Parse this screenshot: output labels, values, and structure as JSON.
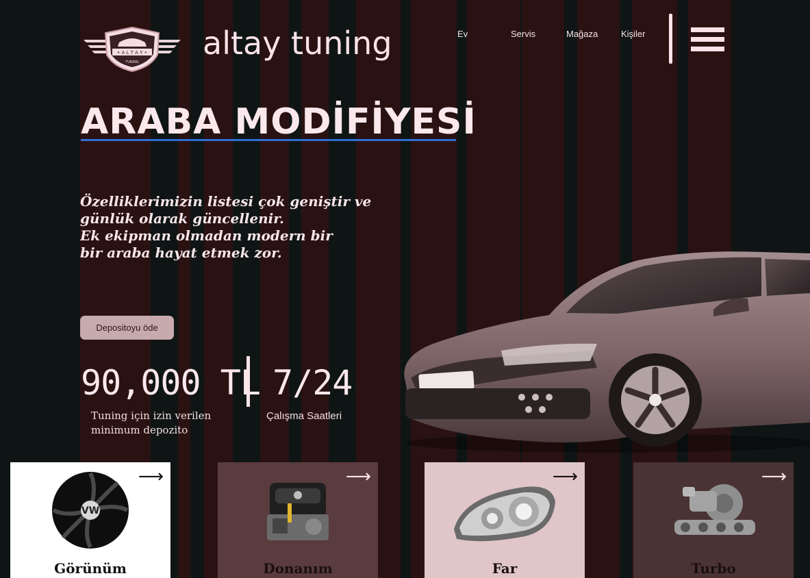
{
  "colors": {
    "background": "#0f1515",
    "stripe_dark_red": "#2a1212",
    "accent_pink": "#fbe3e8",
    "underline_blue": "#2d6fd6",
    "button": "#c7aaae"
  },
  "brand": {
    "name": "altay tuning",
    "logo_icon": "altay-winged-shield-logo"
  },
  "nav": {
    "items": [
      "Ev",
      "Servis",
      "Mağaza",
      "Kişiler"
    ],
    "menu_icon": "hamburger-menu-icon"
  },
  "hero": {
    "title": "ARABA MODİFİYESİ",
    "description": "Özelliklerimizin listesi çok geniştir ve\ngünlük  olarak güncellenir.\nEk ekipman olmadan modern bir\nbir araba hayat etmek zor.",
    "cta_label": "Depositoyu öde"
  },
  "stats": [
    {
      "value": "90,000 TL",
      "caption": "Tuning için izin verilen\nminimum depozito"
    },
    {
      "value": "7/24",
      "caption": "Çalışma Saatleri"
    }
  ],
  "cards": [
    {
      "label": "Görünüm",
      "icon": "wheel-hubcap-icon",
      "arrow": "⟶"
    },
    {
      "label": "Donanım",
      "icon": "engine-icon",
      "arrow": "⟶"
    },
    {
      "label": "Far",
      "icon": "headlight-icon",
      "arrow": "⟶"
    },
    {
      "label": "Turbo",
      "icon": "turbocharger-icon",
      "arrow": "⟶"
    }
  ]
}
